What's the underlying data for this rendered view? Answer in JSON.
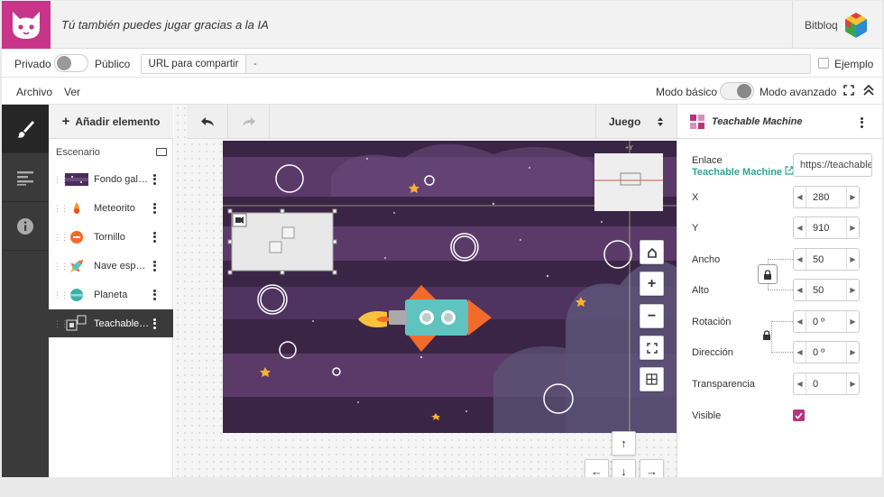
{
  "header": {
    "project_title": "Tú también puedes jugar gracias a la IA",
    "brand": "Bitbloq"
  },
  "share": {
    "private_label": "Privado",
    "public_label": "Público",
    "url_label": "URL para compartir",
    "url_value": "-",
    "example_label": "Ejemplo"
  },
  "menu": {
    "file": "Archivo",
    "view": "Ver",
    "basic_mode": "Modo básico",
    "advanced_mode": "Modo avanzado"
  },
  "elements": {
    "add_label": "Añadir elemento",
    "scenario_label": "Escenario",
    "items": [
      {
        "name": "Fondo galaxia"
      },
      {
        "name": "Meteorito"
      },
      {
        "name": "Tornillo"
      },
      {
        "name": "Nave espacial"
      },
      {
        "name": "Planeta"
      },
      {
        "name": "Teachable Machine"
      }
    ]
  },
  "canvas": {
    "game_label": "Juego",
    "axis_y": "+Y"
  },
  "props": {
    "title": "Teachable Machine",
    "link_label": "Enlace",
    "link_text": "Teachable Machine",
    "link_url": "https://teachablemachine",
    "x_label": "X",
    "x_value": "280",
    "y_label": "Y",
    "y_value": "910",
    "width_label": "Ancho",
    "width_value": "50",
    "height_label": "Alto",
    "height_value": "50",
    "rotation_label": "Rotación",
    "rotation_value": "0 º",
    "direction_label": "Dirección",
    "direction_value": "0 º",
    "transparency_label": "Transparencia",
    "transparency_value": "0",
    "visible_label": "Visible",
    "visible_checked": true
  },
  "colors": {
    "brand_magenta": "#c6358a",
    "sidebar_dark": "#3a3a3a",
    "link_teal": "#2aa59a",
    "space_purple": "#5b3a6a"
  }
}
